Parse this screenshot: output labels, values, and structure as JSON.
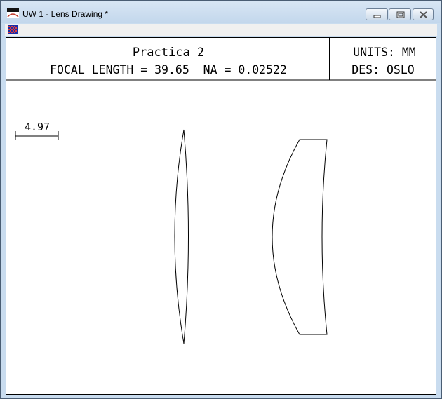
{
  "window": {
    "title": "UW 1 - Lens Drawing *"
  },
  "header": {
    "title": "Practica 2",
    "focal_length_text": "FOCAL LENGTH = 39.65  NA = 0.02522",
    "units_text": "UNITS: MM",
    "designer_text": "DES: OSLO"
  },
  "scale_bar": {
    "label": "4.97"
  },
  "colors": {
    "frame": "#4a5d73",
    "titlebar": "#c9dcef",
    "drawing_line": "#000000"
  },
  "icons": {
    "app": "lens-drawing-app-icon",
    "system_menu": "checkered-system-menu-icon"
  }
}
